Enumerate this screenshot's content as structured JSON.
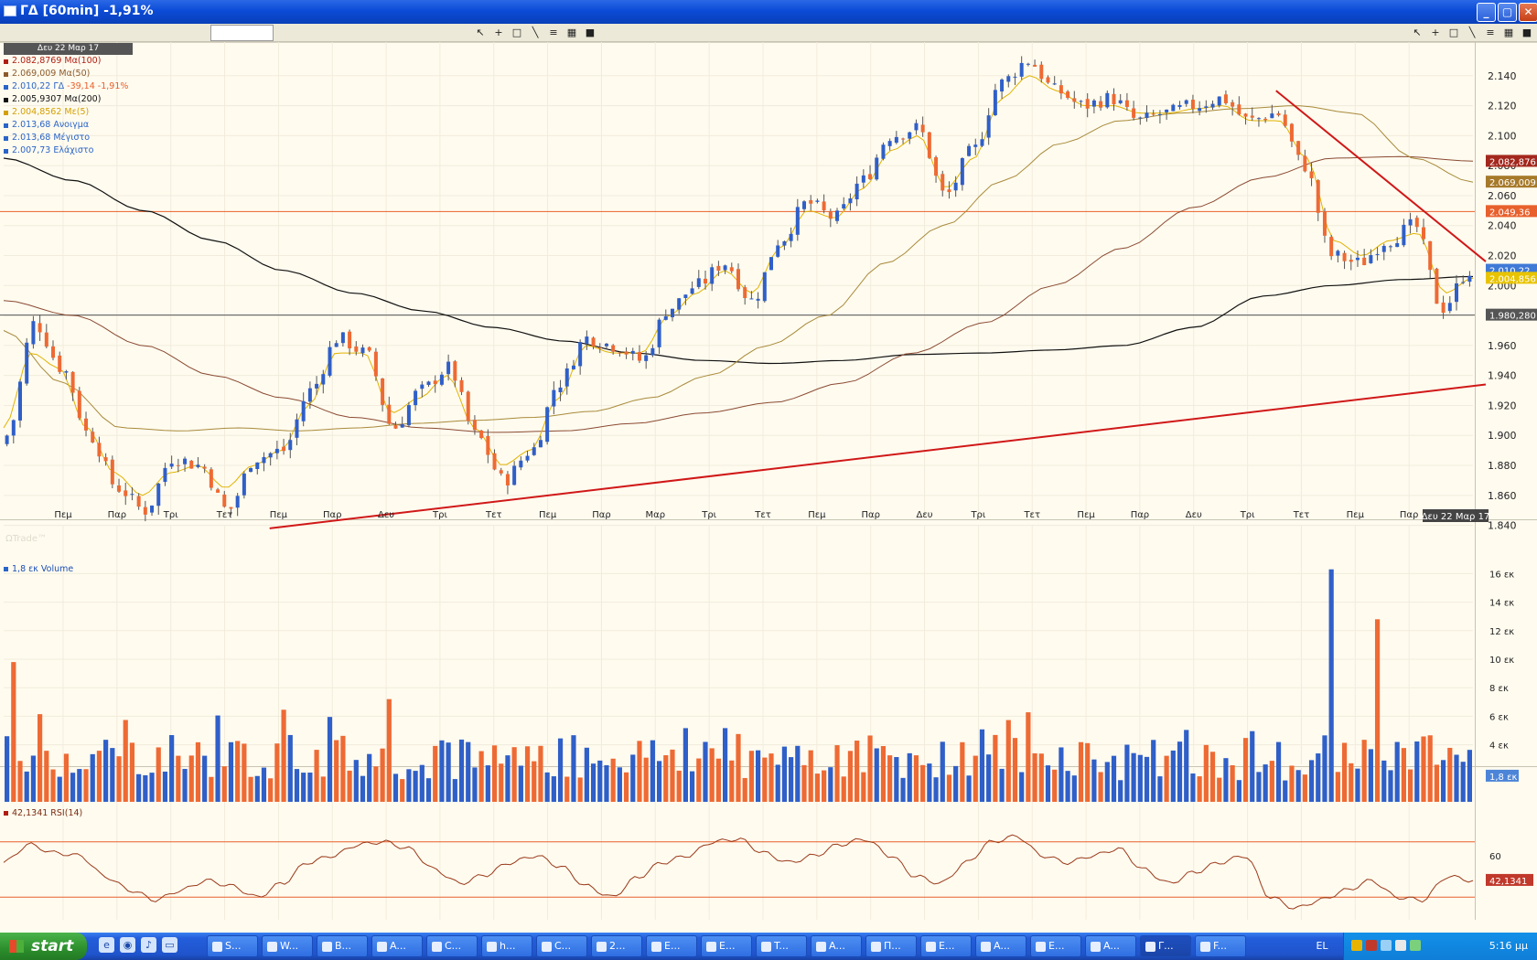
{
  "window": {
    "title": "ΓΔ [60min] -1,91%",
    "buttons": {
      "minimize": "_",
      "maximize": "▢",
      "close": "✕"
    }
  },
  "toolbar": {
    "icons": [
      "cursor-icon",
      "crosshair-icon",
      "rectangle-icon",
      "line-icon",
      "list-icon",
      "chart-icon",
      "save-icon"
    ]
  },
  "price_legend": {
    "header": "Δευ 22 Μαρ 17",
    "items": [
      {
        "text": "2.082,8769 Μα(100)",
        "color": "#b01e12"
      },
      {
        "text": "2.069,009 Μα(50)",
        "color": "#8b5a2b"
      },
      {
        "text": "2.010,22 ΓΔ -39,14 -1,91%",
        "color": "#2a64c8",
        "extra_color": "#e8602c"
      },
      {
        "text": "2.005,9307 Μα(200)",
        "color": "#111111"
      },
      {
        "text": "2.004,8562 Με(5)",
        "color": "#d4a000"
      },
      {
        "text": "2.013,68 Ανοιγμα",
        "color": "#2a64c8"
      },
      {
        "text": "2.013,68 Μέγιστο",
        "color": "#2a64c8"
      },
      {
        "text": "2.007,73 Ελάχιστο",
        "color": "#2a64c8"
      }
    ]
  },
  "price_tags": [
    {
      "text": "2.082,876",
      "color": "#a3271d"
    },
    {
      "text": "2.069,009",
      "color": "#a77a2a"
    },
    {
      "text": "2.049,36",
      "color": "#e8602c"
    },
    {
      "text": "2.010,22",
      "color": "#3f7ad6"
    },
    {
      "text": "2.004,856",
      "color": "#e8c300"
    },
    {
      "text": "1.980,280",
      "color": "#555555"
    }
  ],
  "volume_tag": "1,8 εκ",
  "rsi_tag": "42,1341",
  "date_badge": "Δευ 22 Μαρ 17",
  "volume_legend": "1,8 εκ Volume",
  "rsi_legend": "42,1341 RSI(14)",
  "watermark": "ΩTrade™",
  "chart_data": [
    {
      "type": "candlestick",
      "title": "ΓΔ [60min] -1,91%",
      "ylim": [
        1830,
        2160
      ],
      "y_ticks": [
        "1.840",
        "1.860",
        "1.880",
        "1.900",
        "1.920",
        "1.940",
        "1.960",
        "1.980",
        "2.000",
        "2.020",
        "2.040",
        "2.060",
        "2.080",
        "2.100",
        "2.120",
        "2.140"
      ],
      "x_ticks": [
        "Πεμ",
        "Παρ",
        "Τρι",
        "Τετ",
        "Πεμ",
        "Παρ",
        "Δευ",
        "Τρι",
        "Τετ",
        "Πεμ",
        "Παρ",
        "Μαρ",
        "Τρι",
        "Τετ",
        "Πεμ",
        "Παρ",
        "Δευ",
        "Τρι",
        "Τετ",
        "Πεμ",
        "Παρ",
        "Δευ",
        "Τρι",
        "Τετ",
        "Πεμ",
        "Παρ"
      ],
      "close_anchors": [
        1900,
        1975,
        1945,
        1900,
        1865,
        1850,
        1885,
        1880,
        1850,
        1885,
        1890,
        1930,
        1965,
        1955,
        1905,
        1930,
        1945,
        1900,
        1870,
        1890,
        1935,
        1965,
        1960,
        1950,
        1985,
        2000,
        2015,
        1990,
        2030,
        2055,
        2045,
        2070,
        2100,
        2105,
        2060,
        2090,
        2135,
        2150,
        2130,
        2120,
        2125,
        2110,
        2115,
        2120,
        2125,
        2110,
        2115,
        2080,
        2020,
        2015,
        2030,
        2040,
        1985,
        2010
      ],
      "ma5_anchors": [
        1905,
        1955,
        1945,
        1905,
        1875,
        1860,
        1875,
        1880,
        1865,
        1880,
        1890,
        1920,
        1955,
        1955,
        1915,
        1925,
        1940,
        1905,
        1880,
        1890,
        1925,
        1960,
        1955,
        1955,
        1980,
        1995,
        2010,
        1995,
        2025,
        2050,
        2045,
        2065,
        2090,
        2100,
        2065,
        2085,
        2125,
        2140,
        2130,
        2120,
        2120,
        2115,
        2115,
        2118,
        2120,
        2110,
        2110,
        2085,
        2030,
        2020,
        2030,
        2035,
        1995,
        2005
      ],
      "ma50_anchors": [
        1970,
        1935,
        1905,
        1903,
        1905,
        1903,
        1905,
        1908,
        1910,
        1912,
        1916,
        1925,
        1940,
        1960,
        1980,
        2015,
        2040,
        2070,
        2095,
        2110,
        2115,
        2118,
        2120,
        2115,
        2085,
        2069
      ],
      "ma100_anchors": [
        1990,
        1980,
        1960,
        1940,
        1925,
        1912,
        1905,
        1902,
        1903,
        1908,
        1915,
        1922,
        1935,
        1955,
        1975,
        2000,
        2025,
        2052,
        2072,
        2085,
        2086,
        2083
      ],
      "ma200_anchors": [
        2085,
        2070,
        2050,
        2030,
        2010,
        1995,
        1983,
        1972,
        1963,
        1955,
        1950,
        1948,
        1950,
        1954,
        1955,
        1957,
        1960,
        1972,
        1993,
        2000,
        2004,
        2006
      ],
      "horizontal_levels": [
        {
          "value": 2049.36,
          "color": "#e8602c"
        },
        {
          "value": 1980.28,
          "color": "#555555"
        }
      ],
      "trendlines": [
        {
          "from": [
            0.181,
            1838
          ],
          "to": [
            1.0,
            1934
          ],
          "color": "#d01818"
        },
        {
          "from": [
            0.866,
            2130
          ],
          "to": [
            1.0,
            2016
          ],
          "color": "#d01818"
        }
      ]
    },
    {
      "type": "bar",
      "title": "Volume",
      "unit": "εκ",
      "y_ticks": [
        "4 εκ",
        "6 εκ",
        "8 εκ",
        "10 εκ",
        "12 εκ",
        "14 εκ",
        "16 εκ"
      ],
      "ylim": [
        0,
        17.5
      ],
      "spikes": [
        {
          "index": 201,
          "value": 16.3
        },
        {
          "index": 208,
          "value": 12.8
        },
        {
          "index": 1,
          "value": 9.8
        },
        {
          "index": 58,
          "value": 7.2
        }
      ]
    },
    {
      "type": "line",
      "title": "RSI(14)",
      "ylim": [
        15,
        85
      ],
      "y_ticks": [
        "60"
      ],
      "levels": [
        70,
        30
      ],
      "anchors": [
        55,
        68,
        62,
        60,
        45,
        35,
        28,
        35,
        42,
        38,
        30,
        40,
        55,
        60,
        68,
        70,
        65,
        50,
        40,
        46,
        55,
        60,
        52,
        38,
        30,
        44,
        55,
        60,
        70,
        72,
        62,
        55,
        60,
        68,
        72,
        60,
        45,
        40,
        55,
        70,
        74,
        60,
        55,
        60,
        65,
        50,
        40,
        48,
        55,
        60,
        30,
        22,
        28,
        35,
        42,
        30,
        28,
        45,
        42
      ]
    }
  ]
}
